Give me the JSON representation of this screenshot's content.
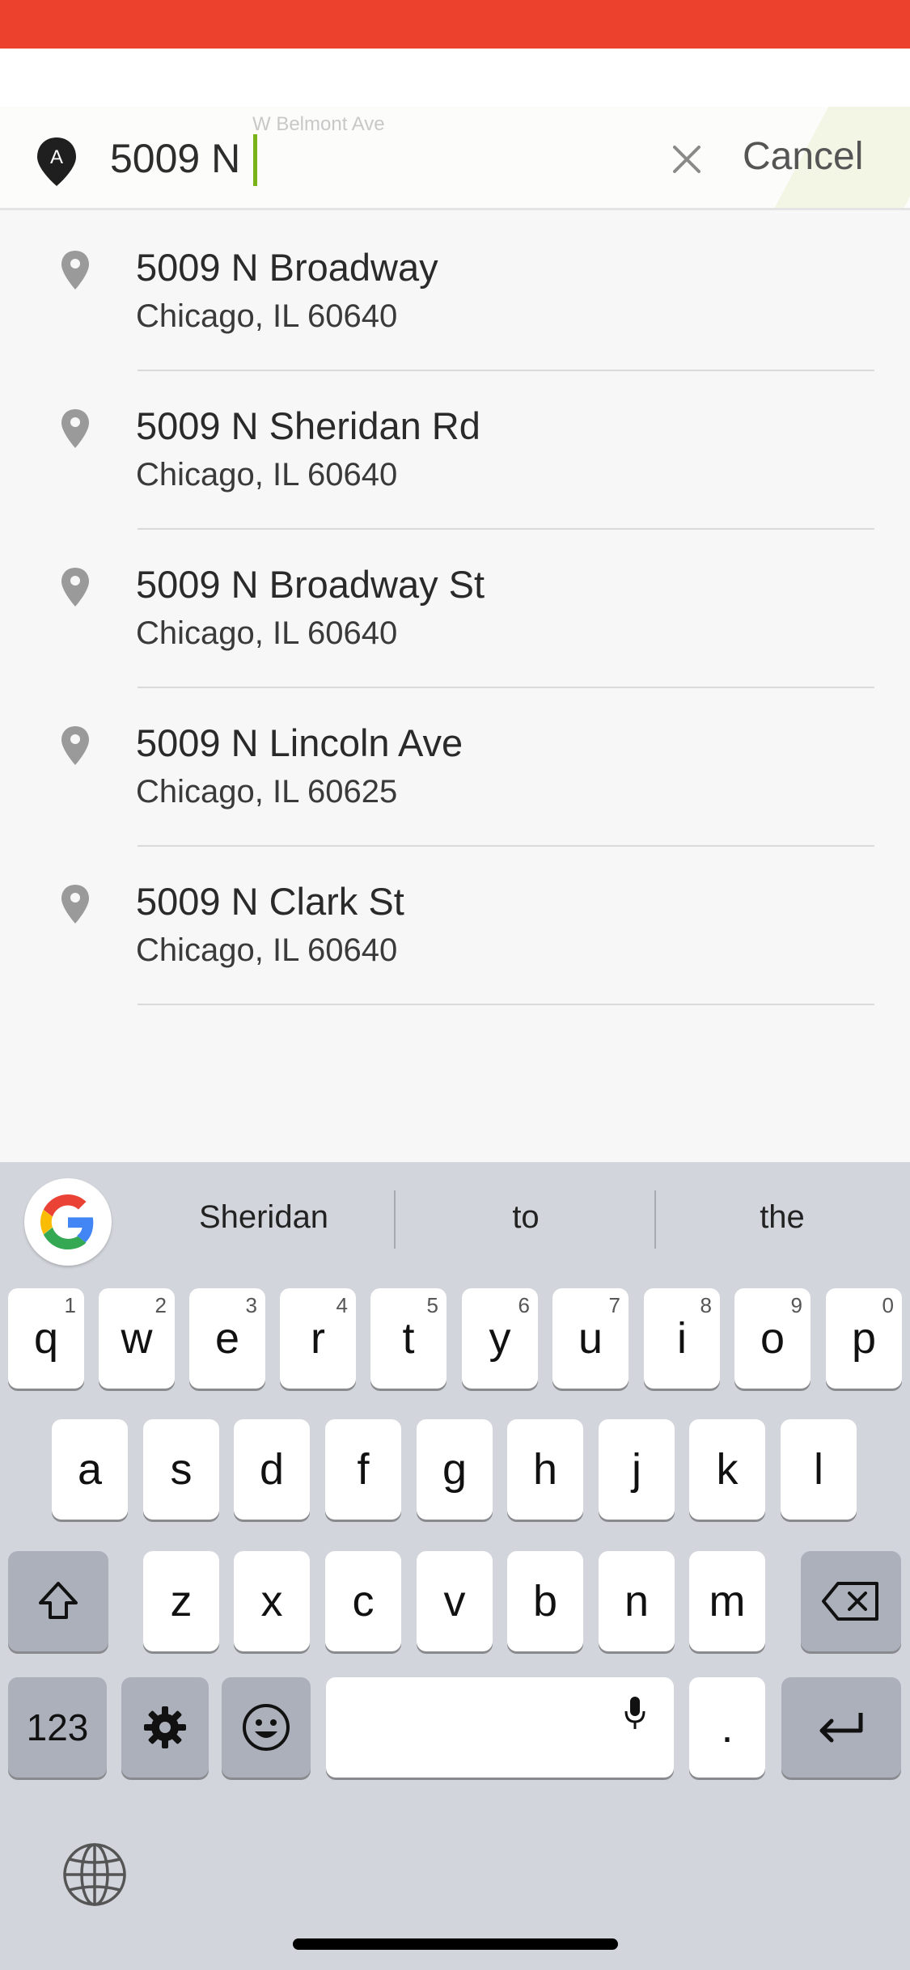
{
  "colors": {
    "status_bar": "#EC412D",
    "caret": "#7AB317",
    "keyboard_bg": "#D2D5DB",
    "pin_gray": "#9A9A9A"
  },
  "search": {
    "map_hint": "W Belmont Ave",
    "origin_pin_letter": "A",
    "origin_pin_icon": "location-pin-icon",
    "value": "5009 N",
    "clear_icon": "close-icon",
    "cancel_label": "Cancel"
  },
  "results": [
    {
      "street": "5009 N Broadway",
      "city": "Chicago, IL 60640",
      "icon": "location-pin-icon"
    },
    {
      "street": "5009 N Sheridan Rd",
      "city": "Chicago, IL 60640",
      "icon": "location-pin-icon"
    },
    {
      "street": "5009 N Broadway St",
      "city": "Chicago, IL 60640",
      "icon": "location-pin-icon"
    },
    {
      "street": "5009 N Lincoln Ave",
      "city": "Chicago, IL 60625",
      "icon": "location-pin-icon"
    },
    {
      "street": "5009 N Clark St",
      "city": "Chicago, IL 60640",
      "icon": "location-pin-icon"
    }
  ],
  "keyboard": {
    "logo_icon": "google-icon",
    "suggestions": [
      "Sheridan",
      "to",
      "the"
    ],
    "row1": [
      {
        "key": "q",
        "hint": "1"
      },
      {
        "key": "w",
        "hint": "2"
      },
      {
        "key": "e",
        "hint": "3"
      },
      {
        "key": "r",
        "hint": "4"
      },
      {
        "key": "t",
        "hint": "5"
      },
      {
        "key": "y",
        "hint": "6"
      },
      {
        "key": "u",
        "hint": "7"
      },
      {
        "key": "i",
        "hint": "8"
      },
      {
        "key": "o",
        "hint": "9"
      },
      {
        "key": "p",
        "hint": "0"
      }
    ],
    "row2": [
      "a",
      "s",
      "d",
      "f",
      "g",
      "h",
      "j",
      "k",
      "l"
    ],
    "row3": [
      "z",
      "x",
      "c",
      "v",
      "b",
      "n",
      "m"
    ],
    "shift_icon": "shift-icon",
    "backspace_icon": "backspace-icon",
    "numbers_label": "123",
    "settings_icon": "gear-icon",
    "emoji_icon": "emoji-icon",
    "mic_icon": "microphone-icon",
    "period_label": ".",
    "return_icon": "return-icon",
    "globe_icon": "globe-icon"
  }
}
